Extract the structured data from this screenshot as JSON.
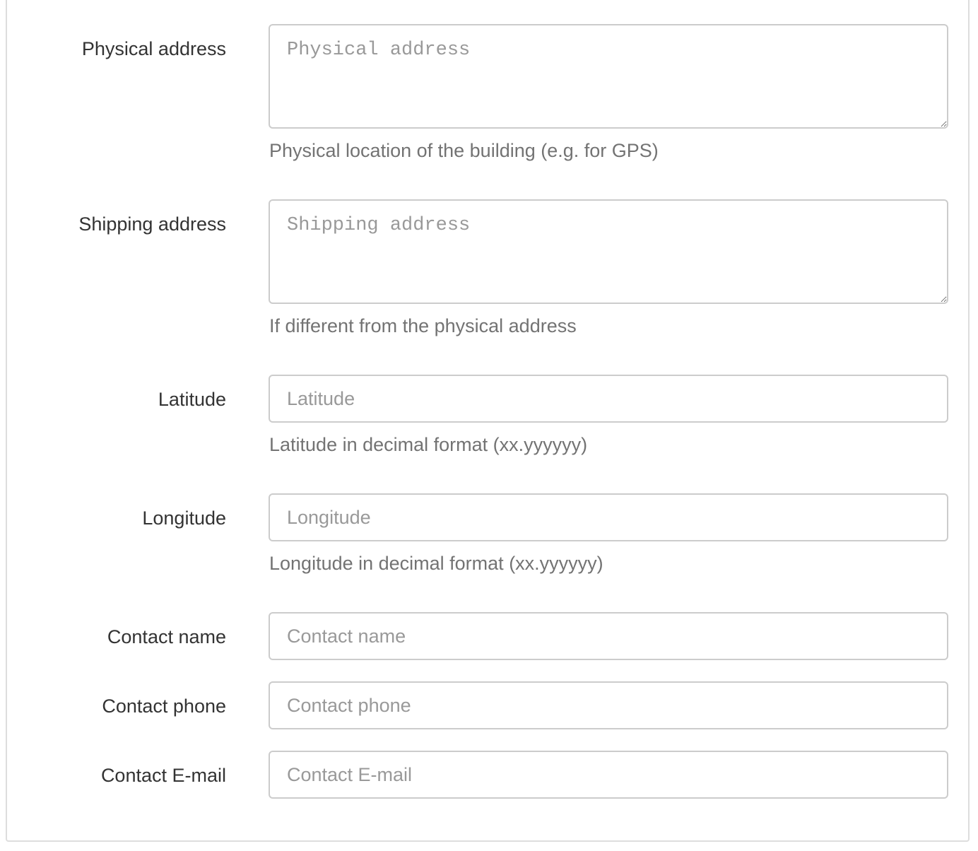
{
  "form": {
    "physical_address": {
      "label": "Physical address",
      "placeholder": "Physical address",
      "value": "",
      "help": "Physical location of the building (e.g. for GPS)"
    },
    "shipping_address": {
      "label": "Shipping address",
      "placeholder": "Shipping address",
      "value": "",
      "help": "If different from the physical address"
    },
    "latitude": {
      "label": "Latitude",
      "placeholder": "Latitude",
      "value": "",
      "help": "Latitude in decimal format (xx.yyyyyy)"
    },
    "longitude": {
      "label": "Longitude",
      "placeholder": "Longitude",
      "value": "",
      "help": "Longitude in decimal format (xx.yyyyyy)"
    },
    "contact_name": {
      "label": "Contact name",
      "placeholder": "Contact name",
      "value": ""
    },
    "contact_phone": {
      "label": "Contact phone",
      "placeholder": "Contact phone",
      "value": ""
    },
    "contact_email": {
      "label": "Contact E-mail",
      "placeholder": "Contact E-mail",
      "value": ""
    }
  }
}
